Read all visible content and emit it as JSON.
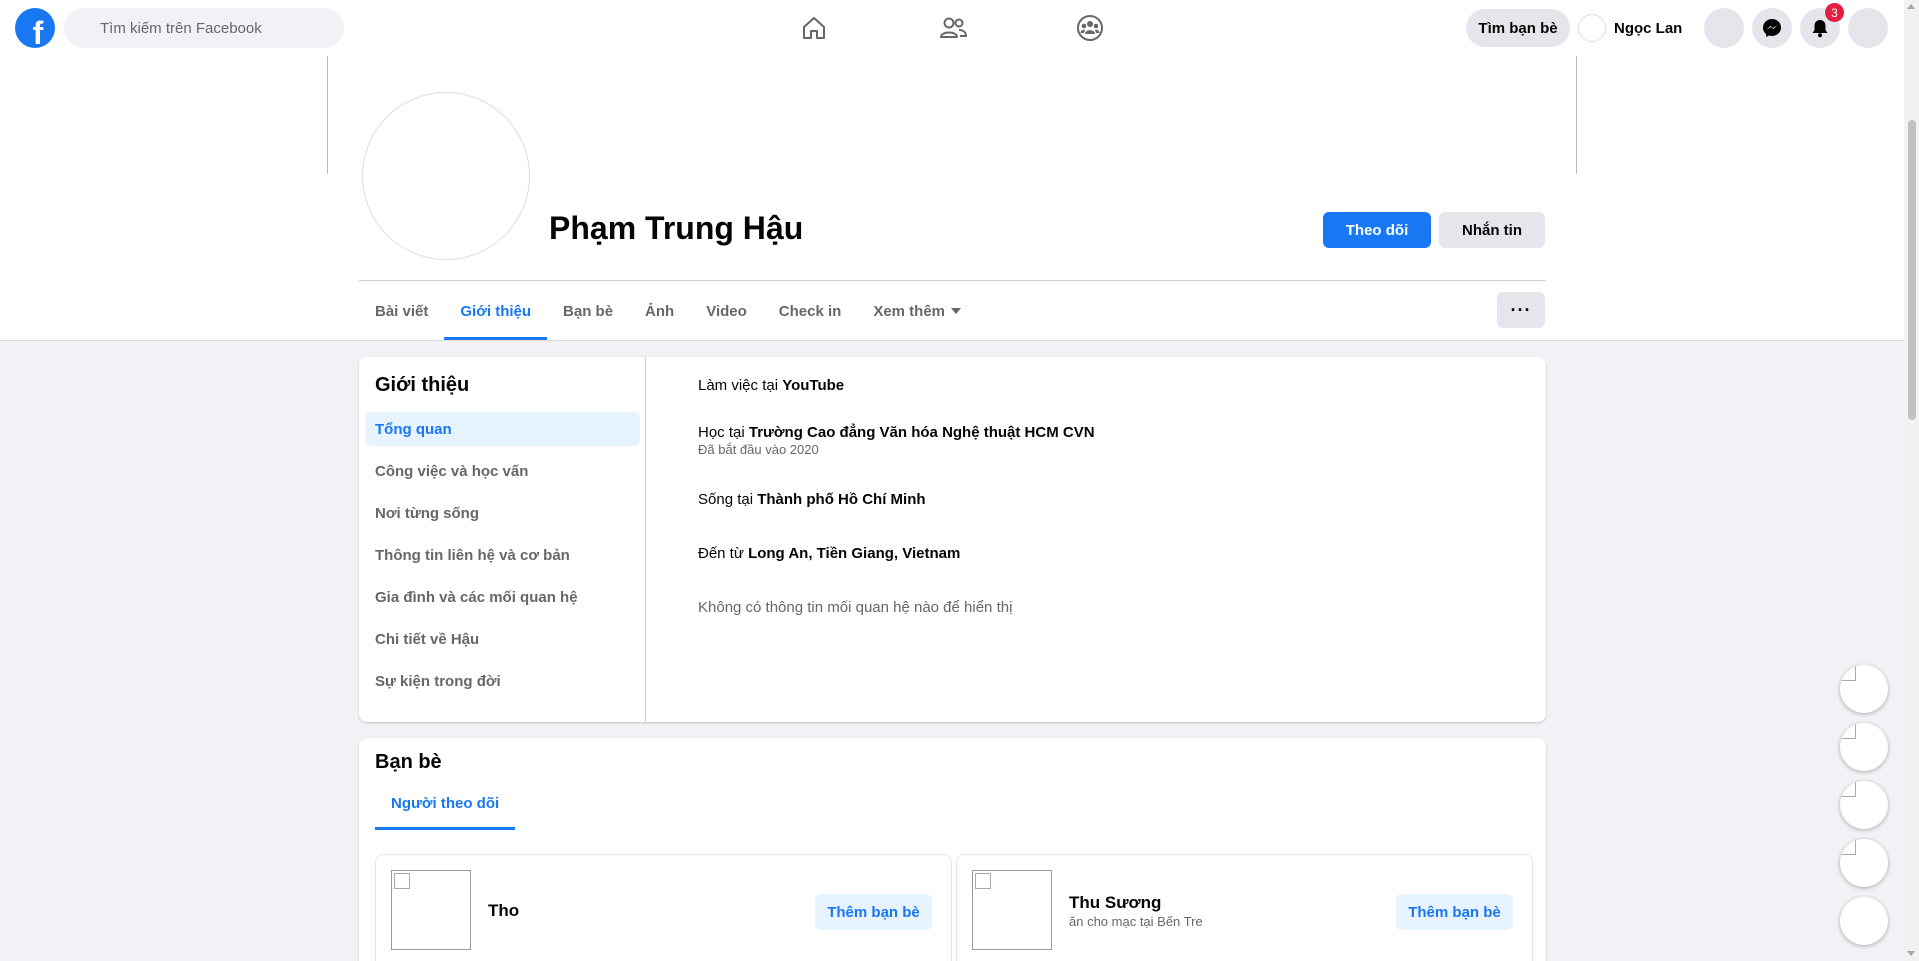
{
  "topbar": {
    "logo_letter": "f",
    "search_placeholder": "Tìm kiếm trên Facebook",
    "find_friends": "Tìm bạn bè",
    "user_name": "Ngọc Lan",
    "notification_count": "3"
  },
  "profile": {
    "name": "Phạm Trung Hậu",
    "follow_label": "Theo dõi",
    "message_label": "Nhắn tin",
    "more_label": "···",
    "tabs": [
      "Bài viết",
      "Giới thiệu",
      "Bạn bè",
      "Ảnh",
      "Video",
      "Check in",
      "Xem thêm"
    ]
  },
  "about": {
    "title": "Giới thiệu",
    "side_items": [
      "Tổng quan",
      "Công việc và học vấn",
      "Nơi từng sống",
      "Thông tin liên hệ và cơ bản",
      "Gia đình và các mối quan hệ",
      "Chi tiết về Hậu",
      "Sự kiện trong đời"
    ],
    "work_prefix": "Làm việc tại ",
    "work_value": "YouTube",
    "study_prefix": "Học tại ",
    "study_value": "Trường Cao đẳng Văn hóa Nghệ thuật HCM CVN",
    "study_sub": "Đã bắt đầu vào 2020",
    "live_prefix": "Sống tại ",
    "live_value": "Thành phố Hồ Chí Minh",
    "from_prefix": "Đến từ ",
    "from_value": "Long An, Tiền Giang, Vietnam",
    "relationship": "Không có thông tin mối quan hệ nào để hiển thị"
  },
  "friends": {
    "title": "Bạn bè",
    "tab_label": "Người theo dõi",
    "items": [
      {
        "name": "Tho",
        "subtitle": "",
        "button": "Thêm bạn bè"
      },
      {
        "name": "Thu Sương",
        "subtitle": "ăn cho mạc tại Bến Tre",
        "button": "Thêm bạn bè"
      }
    ]
  },
  "colors": {
    "brand_blue": "#1877f2",
    "badge_red": "#e41e3f"
  }
}
